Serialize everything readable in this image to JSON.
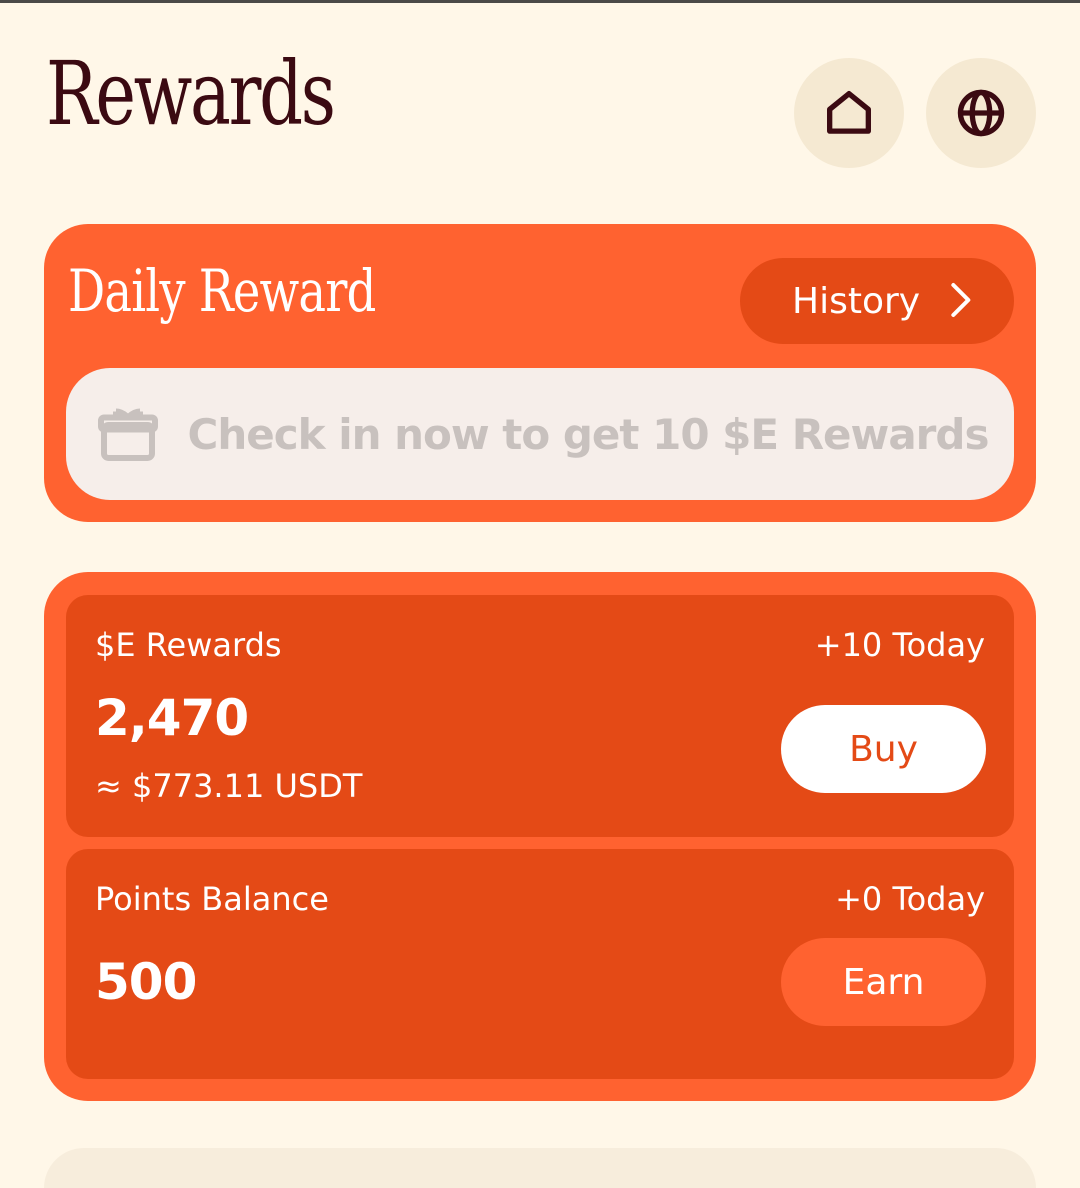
{
  "header": {
    "title": "Rewards",
    "icons": [
      "home-icon",
      "globe-icon"
    ]
  },
  "daily_reward": {
    "title": "Daily Reward",
    "history_label": "History",
    "checkin_text": "Check in now to get 10 $E Rewards",
    "checkin_icon": "gift-icon"
  },
  "balances": {
    "rewards": {
      "label": "$E Rewards",
      "today": "+10 Today",
      "value": "2,470",
      "usdt": "≈ $773.11 USDT",
      "button_label": "Buy"
    },
    "points": {
      "label": "Points Balance",
      "today": "+0 Today",
      "value": "500",
      "button_label": "Earn"
    }
  },
  "colors": {
    "background": "#FFF7E8",
    "accent": "#FF6230",
    "accent_dark": "#E44A16",
    "title": "#3B0A12",
    "icon_button_bg": "#F5E9D2",
    "checkin_bg": "#F6EEEA",
    "checkin_text": "#C8C1BE"
  }
}
